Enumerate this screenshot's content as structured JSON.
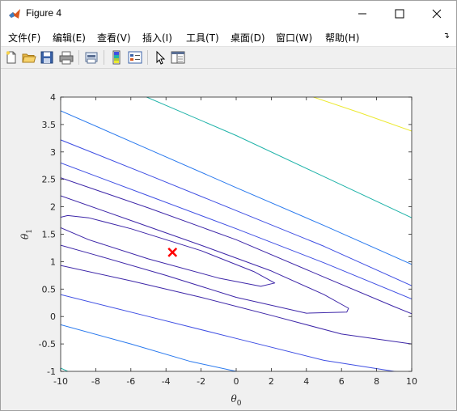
{
  "window": {
    "title": "Figure 4",
    "icon": "matlab-logo-icon",
    "controls": [
      "minimize-icon",
      "maximize-icon",
      "close-icon"
    ]
  },
  "menubar": {
    "items": [
      {
        "label": "文件(F)"
      },
      {
        "label": "编辑(E)"
      },
      {
        "label": "查看(V)"
      },
      {
        "label": "插入(I)"
      },
      {
        "label": "工具(T)"
      },
      {
        "label": "桌面(D)"
      },
      {
        "label": "窗口(W)"
      },
      {
        "label": "帮助(H)"
      }
    ],
    "dock_icon": "dock-arrow-icon"
  },
  "toolbar": {
    "buttons": [
      "new-figure-icon",
      "open-file-icon",
      "save-icon",
      "print-icon",
      "link-plot-icon",
      "insert-colorbar-icon",
      "insert-legend-icon",
      "edit-plot-cursor-icon",
      "property-inspector-icon"
    ]
  },
  "chart_data": {
    "type": "contour",
    "xlabel": "θ",
    "xlabel_sub": "0",
    "ylabel": "θ",
    "ylabel_sub": "1",
    "xlim": [
      -10,
      10
    ],
    "ylim": [
      -1,
      4
    ],
    "xticks": [
      -10,
      -8,
      -6,
      -4,
      -2,
      0,
      2,
      4,
      6,
      8,
      10
    ],
    "yticks": [
      -1,
      -0.5,
      0,
      0.5,
      1,
      1.5,
      2,
      2.5,
      3,
      3.5,
      4
    ],
    "minimum_marker": {
      "x": -3.63,
      "y": 1.17,
      "color": "#ff0000",
      "marker": "x"
    },
    "contours": [
      {
        "color": "#3d26a8",
        "path": [
          [
            -10.0,
            1.81
          ],
          [
            -9.6,
            1.84
          ],
          [
            -8.4,
            1.8
          ],
          [
            -6.0,
            1.6
          ],
          [
            -2.0,
            1.2
          ],
          [
            1.0,
            0.82
          ],
          [
            2.2,
            0.61
          ],
          [
            1.4,
            0.55
          ],
          [
            -1.0,
            0.7
          ],
          [
            -5.0,
            1.05
          ],
          [
            -8.4,
            1.4
          ],
          [
            -10.0,
            1.62
          ]
        ]
      },
      {
        "color": "#3d26a8",
        "path": [
          [
            -10.0,
            2.2
          ],
          [
            -6.0,
            1.75
          ],
          [
            -2.0,
            1.3
          ],
          [
            2.0,
            0.83
          ],
          [
            5.0,
            0.4
          ],
          [
            6.4,
            0.15
          ],
          [
            6.3,
            0.08
          ],
          [
            4.0,
            0.06
          ],
          [
            0.0,
            0.35
          ],
          [
            -4.0,
            0.75
          ],
          [
            -8.0,
            1.12
          ],
          [
            -10.0,
            1.3
          ]
        ]
      },
      {
        "color": "#3d26a8",
        "path": [
          [
            -10.0,
            2.53
          ],
          [
            -5.0,
            1.98
          ],
          [
            0.0,
            1.4
          ],
          [
            5.0,
            0.72
          ],
          [
            9.0,
            0.18
          ],
          [
            10.0,
            0.05
          ]
        ]
      },
      {
        "color": "#3d26a8",
        "path": [
          [
            -10.0,
            0.93
          ],
          [
            -6.0,
            0.65
          ],
          [
            -2.0,
            0.35
          ],
          [
            2.0,
            0.02
          ],
          [
            6.0,
            -0.32
          ],
          [
            10.0,
            -0.5
          ]
        ]
      },
      {
        "color": "#3f4fe3",
        "path": [
          [
            -10.0,
            2.8
          ],
          [
            -5.0,
            2.2
          ],
          [
            0.0,
            1.6
          ],
          [
            5.0,
            0.98
          ],
          [
            10.0,
            0.32
          ]
        ]
      },
      {
        "color": "#3f4fe3",
        "path": [
          [
            -10.0,
            0.4
          ],
          [
            -5.0,
            0.0
          ],
          [
            0.0,
            -0.4
          ],
          [
            5.0,
            -0.8
          ],
          [
            10.0,
            -1.05
          ]
        ]
      },
      {
        "color": "#3f4fe3",
        "path": [
          [
            -10.0,
            3.22
          ],
          [
            -5.0,
            2.58
          ],
          [
            0.0,
            1.93
          ],
          [
            5.0,
            1.28
          ],
          [
            10.0,
            0.56
          ]
        ]
      },
      {
        "color": "#2979ee",
        "path": [
          [
            -10.0,
            3.75
          ],
          [
            -5.0,
            3.05
          ],
          [
            0.0,
            2.35
          ],
          [
            5.0,
            1.66
          ],
          [
            10.0,
            0.95
          ]
        ]
      },
      {
        "color": "#2979ee",
        "path": [
          [
            -10.0,
            -0.15
          ],
          [
            -6.0,
            -0.5
          ],
          [
            -2.6,
            -0.82
          ],
          [
            0.0,
            -1.0
          ]
        ]
      },
      {
        "color": "#20b3a9",
        "path": [
          [
            -5.1,
            4.0
          ],
          [
            0.0,
            3.3
          ],
          [
            5.0,
            2.55
          ],
          [
            10.0,
            1.8
          ]
        ]
      },
      {
        "color": "#20b3a9",
        "path": [
          [
            -10.0,
            -0.94
          ],
          [
            -9.6,
            -1.0
          ]
        ]
      },
      {
        "color": "#ece930",
        "path": [
          [
            4.4,
            4.0
          ],
          [
            7.0,
            3.72
          ],
          [
            10.0,
            3.38
          ]
        ]
      }
    ]
  }
}
